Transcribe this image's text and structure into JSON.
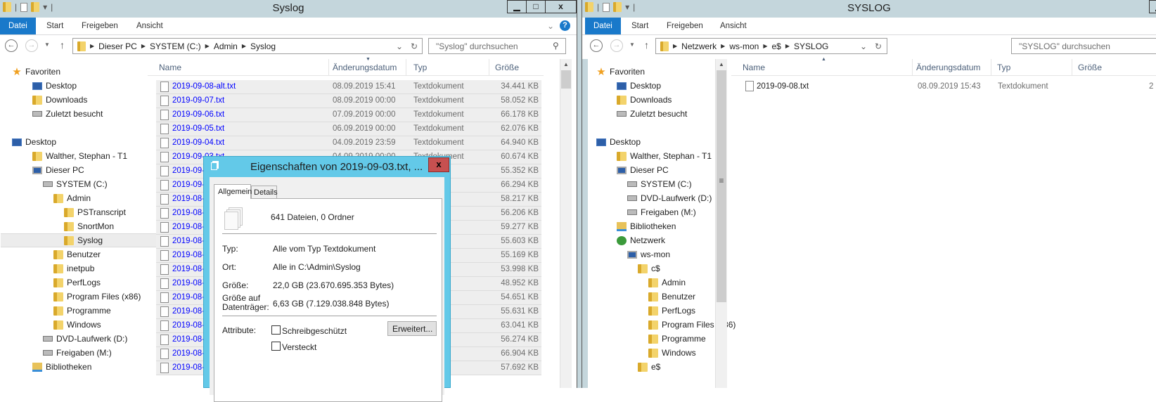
{
  "left": {
    "title": "Syslog",
    "ribbon": [
      "Datei",
      "Start",
      "Freigeben",
      "Ansicht"
    ],
    "breadcrumb": [
      "Dieser PC",
      "SYSTEM (C:)",
      "Admin",
      "Syslog"
    ],
    "search_placeholder": "\"Syslog\" durchsuchen",
    "columns": [
      "Name",
      "Änderungsdatum",
      "Typ",
      "Größe"
    ],
    "nav": [
      {
        "label": "Favoriten",
        "icon": "star-icon",
        "indent": 0
      },
      {
        "label": "Desktop",
        "icon": "desktop-icon",
        "indent": 1
      },
      {
        "label": "Downloads",
        "icon": "downloads-folder-icon",
        "indent": 1
      },
      {
        "label": "Zuletzt besucht",
        "icon": "recent-places-icon",
        "indent": 1
      },
      {
        "label": "",
        "icon": "",
        "indent": 0
      },
      {
        "label": "Desktop",
        "icon": "desktop-icon",
        "indent": 0
      },
      {
        "label": "Walther, Stephan - T1",
        "icon": "user-folder-icon",
        "indent": 1
      },
      {
        "label": "Dieser PC",
        "icon": "computer-icon",
        "indent": 1
      },
      {
        "label": "SYSTEM (C:)",
        "icon": "system-drive-icon",
        "indent": 2
      },
      {
        "label": "Admin",
        "icon": "folder-icon",
        "indent": 3
      },
      {
        "label": "PSTranscript",
        "icon": "folder-icon",
        "indent": 4
      },
      {
        "label": "SnortMon",
        "icon": "folder-icon",
        "indent": 4
      },
      {
        "label": "Syslog",
        "icon": "folder-icon",
        "indent": 4,
        "selected": true
      },
      {
        "label": "Benutzer",
        "icon": "folder-icon",
        "indent": 3
      },
      {
        "label": "inetpub",
        "icon": "folder-icon",
        "indent": 3
      },
      {
        "label": "PerfLogs",
        "icon": "folder-icon",
        "indent": 3
      },
      {
        "label": "Program Files (x86)",
        "icon": "folder-icon",
        "indent": 3
      },
      {
        "label": "Programme",
        "icon": "folder-icon",
        "indent": 3
      },
      {
        "label": "Windows",
        "icon": "folder-icon",
        "indent": 3
      },
      {
        "label": "DVD-Laufwerk (D:)",
        "icon": "dvd-drive-icon",
        "indent": 2
      },
      {
        "label": "Freigaben (M:)",
        "icon": "network-drive-icon",
        "indent": 2
      },
      {
        "label": "Bibliotheken",
        "icon": "libraries-icon",
        "indent": 1
      }
    ],
    "files": [
      {
        "name": "2019-09-08-alt.txt",
        "date": "08.09.2019 15:41",
        "type": "Textdokument",
        "size": "34.441 KB"
      },
      {
        "name": "2019-09-07.txt",
        "date": "08.09.2019 00:00",
        "type": "Textdokument",
        "size": "58.052 KB"
      },
      {
        "name": "2019-09-06.txt",
        "date": "07.09.2019 00:00",
        "type": "Textdokument",
        "size": "66.178 KB"
      },
      {
        "name": "2019-09-05.txt",
        "date": "06.09.2019 00:00",
        "type": "Textdokument",
        "size": "62.076 KB"
      },
      {
        "name": "2019-09-04.txt",
        "date": "04.09.2019 23:59",
        "type": "Textdokument",
        "size": "64.940 KB"
      },
      {
        "name": "2019-09-03.txt",
        "date": "04.09.2019 00:00",
        "type": "Textdokument",
        "size": "60.674 KB"
      },
      {
        "name": "2019-09-",
        "date": "",
        "type": "ent",
        "size": "55.352 KB"
      },
      {
        "name": "2019-09-",
        "date": "",
        "type": "ent",
        "size": "66.294 KB"
      },
      {
        "name": "2019-08-",
        "date": "",
        "type": "ent",
        "size": "58.217 KB"
      },
      {
        "name": "2019-08-",
        "date": "",
        "type": "ent",
        "size": "56.206 KB"
      },
      {
        "name": "2019-08-",
        "date": "",
        "type": "ent",
        "size": "59.277 KB"
      },
      {
        "name": "2019-08-",
        "date": "",
        "type": "ent",
        "size": "55.603 KB"
      },
      {
        "name": "2019-08-",
        "date": "",
        "type": "ent",
        "size": "55.169 KB"
      },
      {
        "name": "2019-08-",
        "date": "",
        "type": "ent",
        "size": "53.998 KB"
      },
      {
        "name": "2019-08-",
        "date": "",
        "type": "ent",
        "size": "48.952 KB"
      },
      {
        "name": "2019-08-",
        "date": "",
        "type": "ent",
        "size": "54.651 KB"
      },
      {
        "name": "2019-08-",
        "date": "",
        "type": "ent",
        "size": "55.631 KB"
      },
      {
        "name": "2019-08-",
        "date": "",
        "type": "ent",
        "size": "63.041 KB"
      },
      {
        "name": "2019-08-",
        "date": "",
        "type": "ent",
        "size": "56.274 KB"
      },
      {
        "name": "2019-08-",
        "date": "",
        "type": "ent",
        "size": "66.904 KB"
      },
      {
        "name": "2019-08-",
        "date": "",
        "type": "ent",
        "size": "57.692 KB"
      }
    ]
  },
  "dialog": {
    "title": "Eigenschaften von 2019-09-03.txt, ...",
    "close": "x",
    "tabs": [
      "Allgemein",
      "Details"
    ],
    "summary": "641 Dateien, 0 Ordner",
    "fields": [
      {
        "label": "Typ:",
        "value": "Alle vom Typ Textdokument"
      },
      {
        "label": "Ort:",
        "value": "Alle in C:\\Admin\\Syslog"
      },
      {
        "label": "Größe:",
        "value": "22,0 GB (23.670.695.353 Bytes)"
      },
      {
        "label": "Größe auf Datenträger:",
        "value": "6,63 GB (7.129.038.848 Bytes)"
      }
    ],
    "attributes_label": "Attribute:",
    "readonly_label": "Schreibgeschützt",
    "hidden_label": "Versteckt",
    "advanced_button": "Erweitert...",
    "readonly_checked": false,
    "hidden_checked": false
  },
  "right": {
    "title": "SYSLOG",
    "ribbon": [
      "Datei",
      "Start",
      "Freigeben",
      "Ansicht"
    ],
    "breadcrumb": [
      "Netzwerk",
      "ws-mon",
      "e$",
      "SYSLOG"
    ],
    "search_placeholder": "\"SYSLOG\" durchsuchen",
    "columns": [
      "Name",
      "Änderungsdatum",
      "Typ",
      "Größe"
    ],
    "nav": [
      {
        "label": "Favoriten",
        "icon": "star-icon",
        "indent": 0
      },
      {
        "label": "Desktop",
        "icon": "desktop-icon",
        "indent": 1
      },
      {
        "label": "Downloads",
        "icon": "downloads-folder-icon",
        "indent": 1
      },
      {
        "label": "Zuletzt besucht",
        "icon": "recent-places-icon",
        "indent": 1
      },
      {
        "label": "",
        "icon": "",
        "indent": 0
      },
      {
        "label": "Desktop",
        "icon": "desktop-icon",
        "indent": 0
      },
      {
        "label": "Walther, Stephan - T1",
        "icon": "user-folder-icon",
        "indent": 1
      },
      {
        "label": "Dieser PC",
        "icon": "computer-icon",
        "indent": 1
      },
      {
        "label": "SYSTEM (C:)",
        "icon": "system-drive-icon",
        "indent": 2
      },
      {
        "label": "DVD-Laufwerk (D:)",
        "icon": "dvd-drive-icon",
        "indent": 2
      },
      {
        "label": "Freigaben (M:)",
        "icon": "network-drive-icon",
        "indent": 2
      },
      {
        "label": "Bibliotheken",
        "icon": "libraries-icon",
        "indent": 1
      },
      {
        "label": "Netzwerk",
        "icon": "network-icon",
        "indent": 1
      },
      {
        "label": "ws-mon",
        "icon": "computer-icon",
        "indent": 2
      },
      {
        "label": "c$",
        "icon": "share-folder-icon",
        "indent": 3
      },
      {
        "label": "Admin",
        "icon": "folder-icon",
        "indent": 4
      },
      {
        "label": "Benutzer",
        "icon": "folder-icon",
        "indent": 4
      },
      {
        "label": "PerfLogs",
        "icon": "folder-icon",
        "indent": 4
      },
      {
        "label": "Program Files (x86)",
        "icon": "folder-icon",
        "indent": 4
      },
      {
        "label": "Programme",
        "icon": "folder-icon",
        "indent": 4
      },
      {
        "label": "Windows",
        "icon": "folder-icon",
        "indent": 4
      },
      {
        "label": "e$",
        "icon": "share-folder-icon",
        "indent": 3
      }
    ],
    "files": [
      {
        "name": "2019-09-08.txt",
        "date": "08.09.2019 15:43",
        "type": "Textdokument",
        "size": "2"
      }
    ]
  },
  "colors": {
    "titlebar": "#c4d6dc",
    "file_tab": "#1979ca",
    "dialog_frame": "#63c9e8",
    "close_button": "#c75050",
    "link": "#0000ff"
  }
}
